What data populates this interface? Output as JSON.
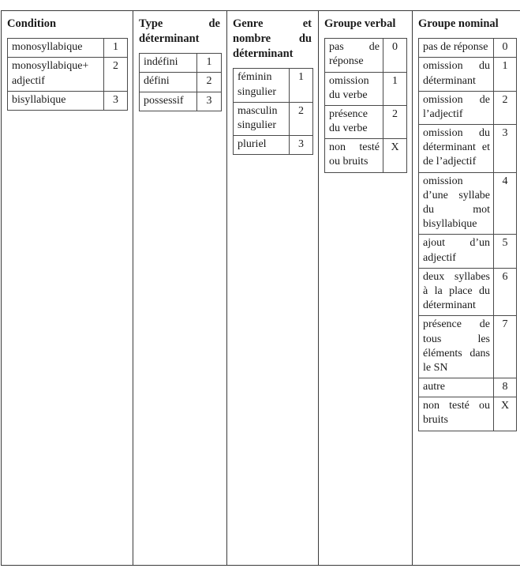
{
  "table": {
    "columns": [
      {
        "header": "Condition",
        "header_justified": false,
        "rows": [
          {
            "label": "monosyllabique",
            "code": "1"
          },
          {
            "label": "monosyllabique+ adjectif",
            "code": "2"
          },
          {
            "label": "bisyllabique",
            "code": "3"
          }
        ]
      },
      {
        "header": "Type de déterminant",
        "header_justified": true,
        "rows": [
          {
            "label": "indéfini",
            "code": "1"
          },
          {
            "label": "défini",
            "code": "2"
          },
          {
            "label": "possessif",
            "code": "3"
          }
        ]
      },
      {
        "header": "Genre et nombre du déterminant",
        "header_justified": true,
        "rows": [
          {
            "label": "féminin singulier",
            "code": "1"
          },
          {
            "label": "masculin singulier",
            "code": "2"
          },
          {
            "label": "pluriel",
            "code": "3"
          }
        ]
      },
      {
        "header": "Groupe verbal",
        "header_justified": false,
        "rows": [
          {
            "label": "pas de réponse",
            "code": "0"
          },
          {
            "label": "omission du verbe",
            "code": "1"
          },
          {
            "label": "présence du verbe",
            "code": "2"
          },
          {
            "label": "non testé ou bruits",
            "code": "X"
          }
        ]
      },
      {
        "header": "Groupe nominal",
        "header_justified": false,
        "rows": [
          {
            "label": "pas de réponse",
            "code": "0"
          },
          {
            "label": "omission du déterminant",
            "code": "1"
          },
          {
            "label": "omission de l’adjectif",
            "code": "2"
          },
          {
            "label": "omission du déterminant et de l’adjectif",
            "code": "3"
          },
          {
            "label": "omission d’une syllabe du mot bisyllabique",
            "code": "4"
          },
          {
            "label": "ajout d’un adjectif",
            "code": "5"
          },
          {
            "label": "deux syllabes à la place du déterminant",
            "code": "6"
          },
          {
            "label": "présence de tous les éléments dans le SN",
            "code": "7"
          },
          {
            "label": "autre",
            "code": "8"
          },
          {
            "label": "non testé ou bruits",
            "code": "X"
          }
        ]
      }
    ]
  }
}
